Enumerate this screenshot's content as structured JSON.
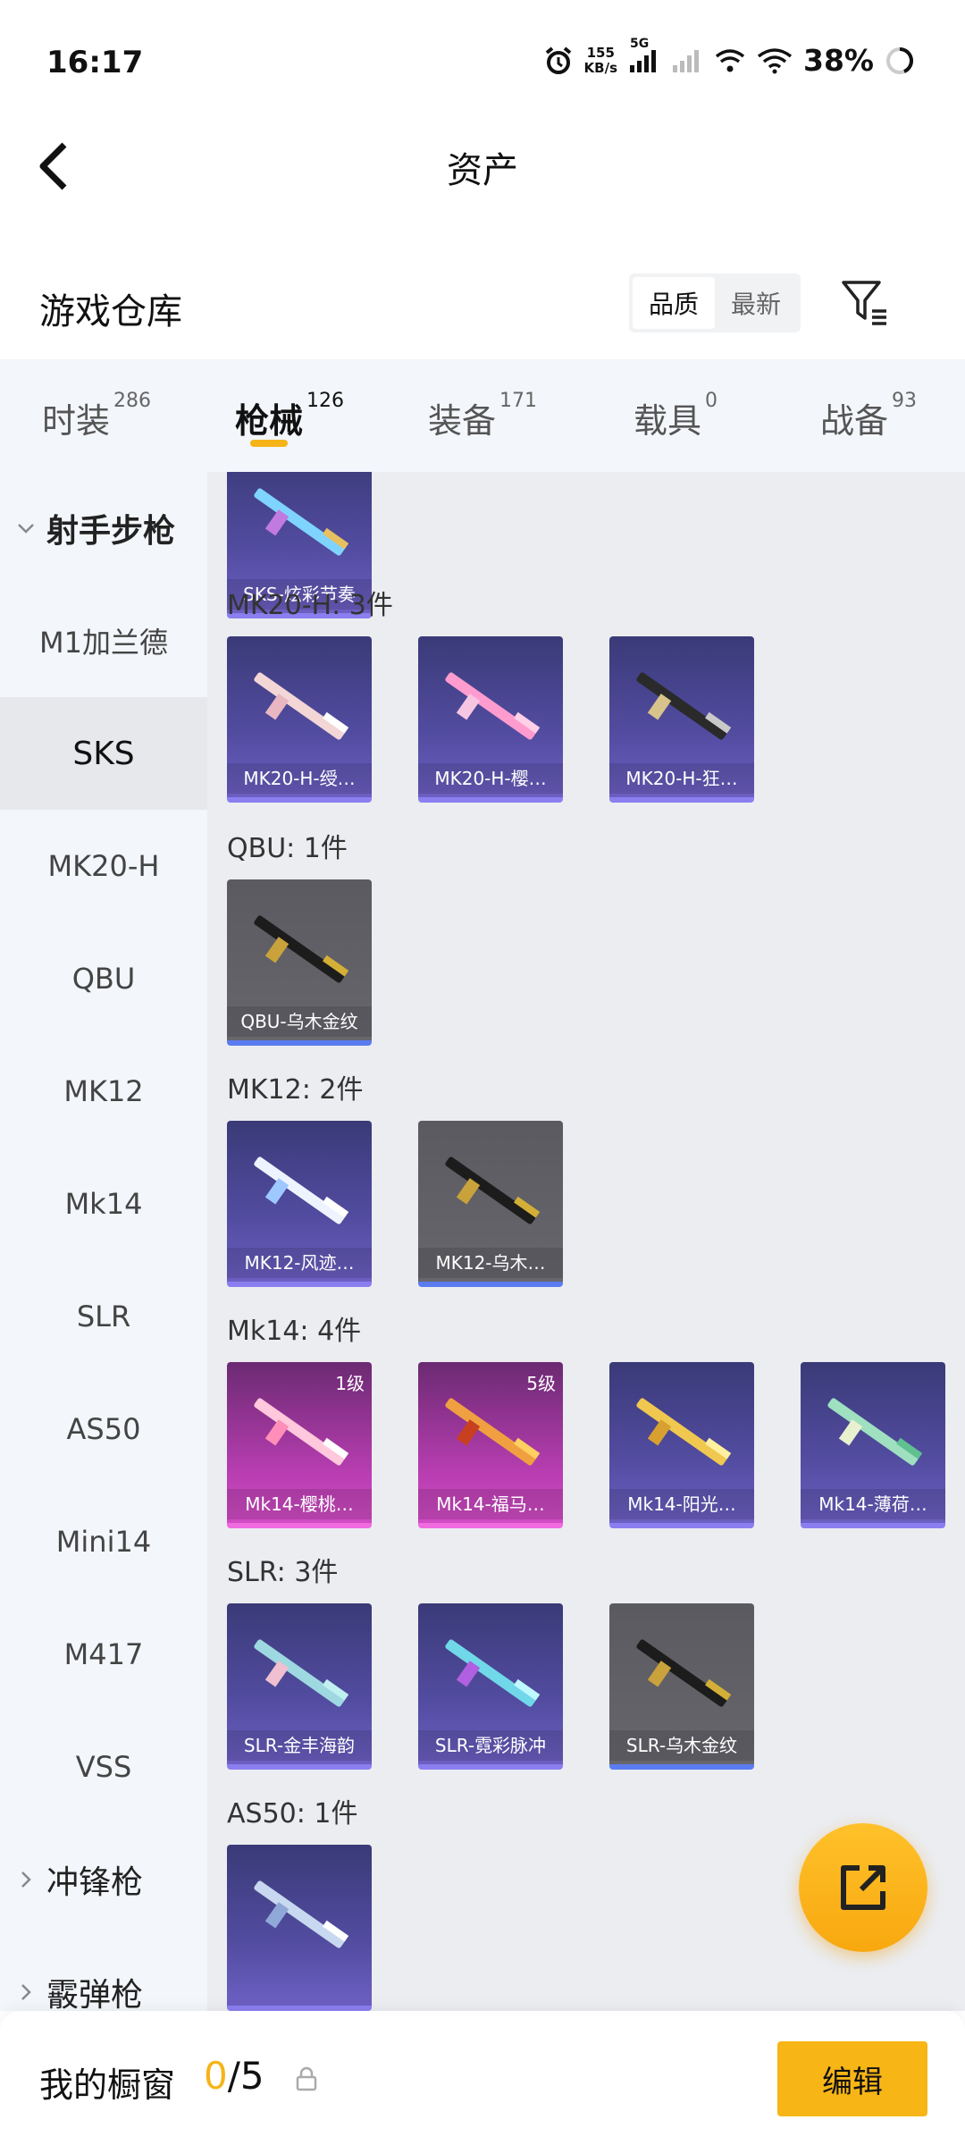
{
  "status_bar": {
    "time": "16:17",
    "net_speed_value": "155",
    "net_speed_unit": "KB/s",
    "network_type": "5G",
    "battery_percent": "38%"
  },
  "header": {
    "title": "资产"
  },
  "warehouse": {
    "title": "游戏仓库",
    "sort_options": [
      "品质",
      "最新"
    ],
    "sort_selected": "品质"
  },
  "tabs": [
    {
      "label": "时装",
      "count": "286"
    },
    {
      "label": "枪械",
      "count": "126",
      "active": true
    },
    {
      "label": "装备",
      "count": "171"
    },
    {
      "label": "载具",
      "count": "0"
    },
    {
      "label": "战备",
      "count": "93"
    }
  ],
  "sidebar": {
    "group_expanded": "射手步枪",
    "items": [
      "M1加兰德",
      "SKS",
      "MK20-H",
      "QBU",
      "MK12",
      "Mk14",
      "SLR",
      "AS50",
      "Mini14",
      "M417",
      "VSS"
    ],
    "selected": "SKS",
    "collapsed_groups": [
      "冲锋枪",
      "霰弹枪"
    ]
  },
  "sections": [
    {
      "label": "",
      "items": [
        {
          "name": "SKS-炫彩节奏",
          "rarity": "blue"
        }
      ]
    },
    {
      "label": "MK20-H: 3件",
      "items": [
        {
          "name": "MK20-H-绶…",
          "rarity": "blue"
        },
        {
          "name": "MK20-H-樱…",
          "rarity": "blue"
        },
        {
          "name": "MK20-H-狂…",
          "rarity": "blue"
        }
      ]
    },
    {
      "label": "QBU: 1件",
      "items": [
        {
          "name": "QBU-乌木金纹",
          "rarity": "gray"
        }
      ]
    },
    {
      "label": "MK12: 2件",
      "items": [
        {
          "name": "MK12-风迹…",
          "rarity": "blue"
        },
        {
          "name": "MK12-乌木…",
          "rarity": "gray"
        }
      ]
    },
    {
      "label": "Mk14: 4件",
      "items": [
        {
          "name": "Mk14-樱桃…",
          "rarity": "pink",
          "level": "1级"
        },
        {
          "name": "Mk14-福马…",
          "rarity": "pink",
          "level": "5级"
        },
        {
          "name": "Mk14-阳光…",
          "rarity": "blue"
        },
        {
          "name": "Mk14-薄荷…",
          "rarity": "blue"
        }
      ]
    },
    {
      "label": "SLR: 3件",
      "items": [
        {
          "name": "SLR-金丰海韵",
          "rarity": "blue"
        },
        {
          "name": "SLR-霓彩脉冲",
          "rarity": "blue"
        },
        {
          "name": "SLR-乌木金纹",
          "rarity": "gray"
        }
      ]
    },
    {
      "label": "AS50: 1件",
      "items": [
        {
          "name": "",
          "rarity": "blue"
        }
      ]
    }
  ],
  "bottom_bar": {
    "showcase_label": "我的橱窗",
    "showcase_current": "0",
    "showcase_total": "/5",
    "edit_label": "编辑"
  },
  "colors": {
    "accent": "#f6b418",
    "card_blue": "#524ca0",
    "card_pink": "#b93eb2",
    "card_gray": "#66666c"
  },
  "icons": [
    "back-arrow-icon",
    "filter-icon",
    "share-external-icon",
    "lock-icon",
    "alarm-icon",
    "signal-icon",
    "wifi-icon"
  ]
}
